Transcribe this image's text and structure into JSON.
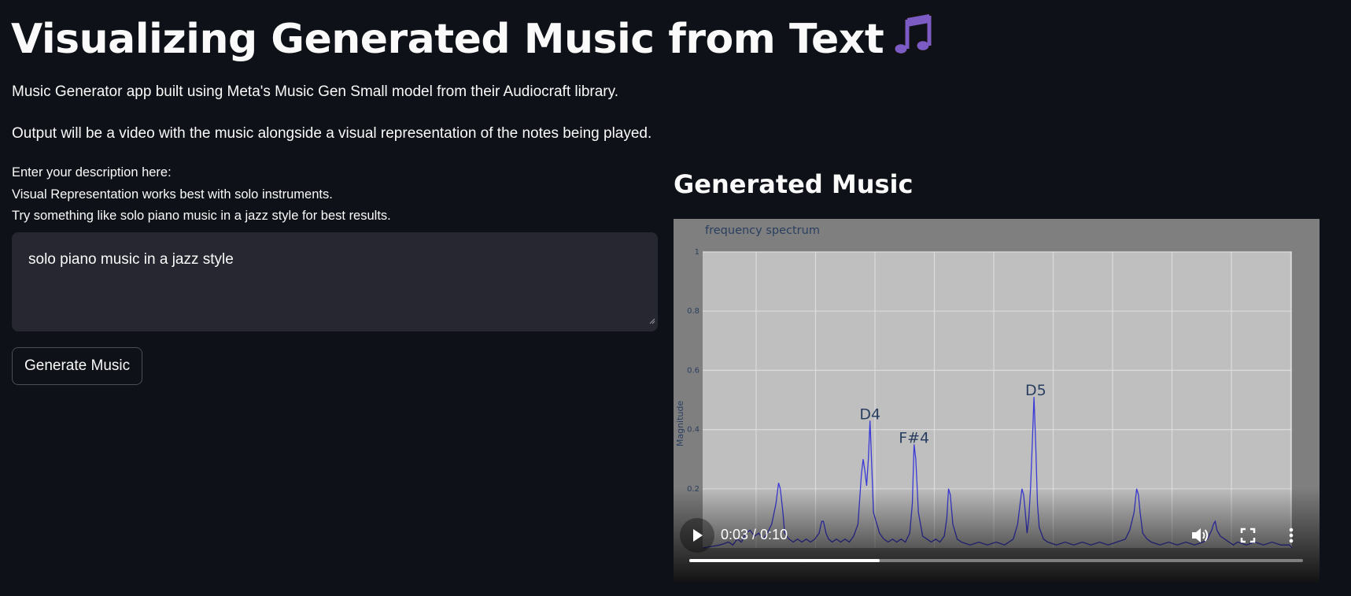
{
  "header": {
    "title": "Visualizing Generated Music from Text",
    "title_icon": "musical-notes-icon"
  },
  "intro": {
    "line1": "Music Generator app built using Meta's Music Gen Small model from their Audiocraft library.",
    "line2": "Output will be a video with the music alongside a visual representation of the notes being played."
  },
  "form": {
    "label1": "Enter your description here:",
    "label2": "Visual Representation works best with solo instruments.",
    "label3": "Try something like solo piano music in a jazz style for best results.",
    "prompt_value": "solo piano music in a jazz style",
    "generate_label": "Generate Music"
  },
  "output": {
    "heading": "Generated Music",
    "video": {
      "current_time": "0:03",
      "duration": "0:10",
      "time_display": "0:03 / 0:10",
      "progress": 0.31
    }
  },
  "chart_data": {
    "type": "line",
    "title": "frequency spectrum",
    "ylabel": "Magnitude",
    "xlabel": "",
    "ylim": [
      0,
      1
    ],
    "yticks": [
      "0.2",
      "0.4",
      "0.6",
      "0.8",
      "1"
    ],
    "grid": true,
    "series": [
      {
        "color": "#3a3ad8",
        "x": [
          0,
          10,
          20,
          30,
          35,
          40,
          45,
          50,
          55,
          60,
          65,
          70,
          75,
          80,
          85,
          88,
          90,
          93,
          95,
          100,
          105,
          110,
          115,
          120,
          125,
          130,
          135,
          138,
          140,
          143,
          146,
          150,
          155,
          160,
          165,
          170,
          175,
          180,
          184,
          186,
          188,
          190,
          192,
          194,
          196,
          198,
          200,
          205,
          210,
          215,
          220,
          225,
          230,
          235,
          240,
          243,
          245,
          247,
          250,
          255,
          260,
          265,
          270,
          275,
          280,
          283,
          285,
          287,
          290,
          295,
          300,
          310,
          320,
          330,
          340,
          350,
          360,
          365,
          370,
          372,
          374,
          376,
          378,
          380,
          382,
          384,
          386,
          388,
          390,
          395,
          400,
          410,
          420,
          430,
          440,
          450,
          460,
          470,
          480,
          490,
          495,
          500,
          503,
          505,
          507,
          510,
          515,
          520,
          530,
          540,
          550,
          560,
          570,
          580,
          585,
          590,
          592,
          594,
          596,
          600,
          605,
          610,
          615,
          620,
          630,
          640,
          650,
          660,
          670,
          680,
          683
        ],
        "values": [
          0,
          0.005,
          0.01,
          0.02,
          0.01,
          0.03,
          0.02,
          0.05,
          0.06,
          0.04,
          0.05,
          0.03,
          0.05,
          0.08,
          0.15,
          0.22,
          0.2,
          0.12,
          0.05,
          0.03,
          0.02,
          0.03,
          0.02,
          0.03,
          0.02,
          0.03,
          0.05,
          0.09,
          0.09,
          0.05,
          0.03,
          0.02,
          0.03,
          0.02,
          0.03,
          0.02,
          0.04,
          0.08,
          0.25,
          0.3,
          0.26,
          0.21,
          0.3,
          0.43,
          0.28,
          0.12,
          0.1,
          0.05,
          0.03,
          0.02,
          0.03,
          0.02,
          0.03,
          0.02,
          0.05,
          0.15,
          0.35,
          0.3,
          0.12,
          0.04,
          0.03,
          0.02,
          0.03,
          0.02,
          0.04,
          0.1,
          0.2,
          0.18,
          0.08,
          0.03,
          0.02,
          0.01,
          0.02,
          0.01,
          0.02,
          0.01,
          0.03,
          0.08,
          0.2,
          0.18,
          0.12,
          0.05,
          0.1,
          0.2,
          0.35,
          0.51,
          0.35,
          0.15,
          0.07,
          0.03,
          0.02,
          0.01,
          0.02,
          0.01,
          0.02,
          0.01,
          0.02,
          0.01,
          0.02,
          0.03,
          0.06,
          0.12,
          0.2,
          0.18,
          0.12,
          0.05,
          0.03,
          0.02,
          0.01,
          0.02,
          0.01,
          0.02,
          0.01,
          0.02,
          0.03,
          0.06,
          0.08,
          0.09,
          0.06,
          0.04,
          0.03,
          0.02,
          0.01,
          0.02,
          0.01,
          0.02,
          0.01,
          0.02,
          0.01,
          0.01,
          0
        ]
      }
    ],
    "annotations": [
      {
        "text": "D4",
        "x": 194,
        "y": 0.43
      },
      {
        "text": "F#4",
        "x": 245,
        "y": 0.35
      },
      {
        "text": "D5",
        "x": 386,
        "y": 0.51
      }
    ],
    "xlim": [
      0,
      683
    ]
  }
}
